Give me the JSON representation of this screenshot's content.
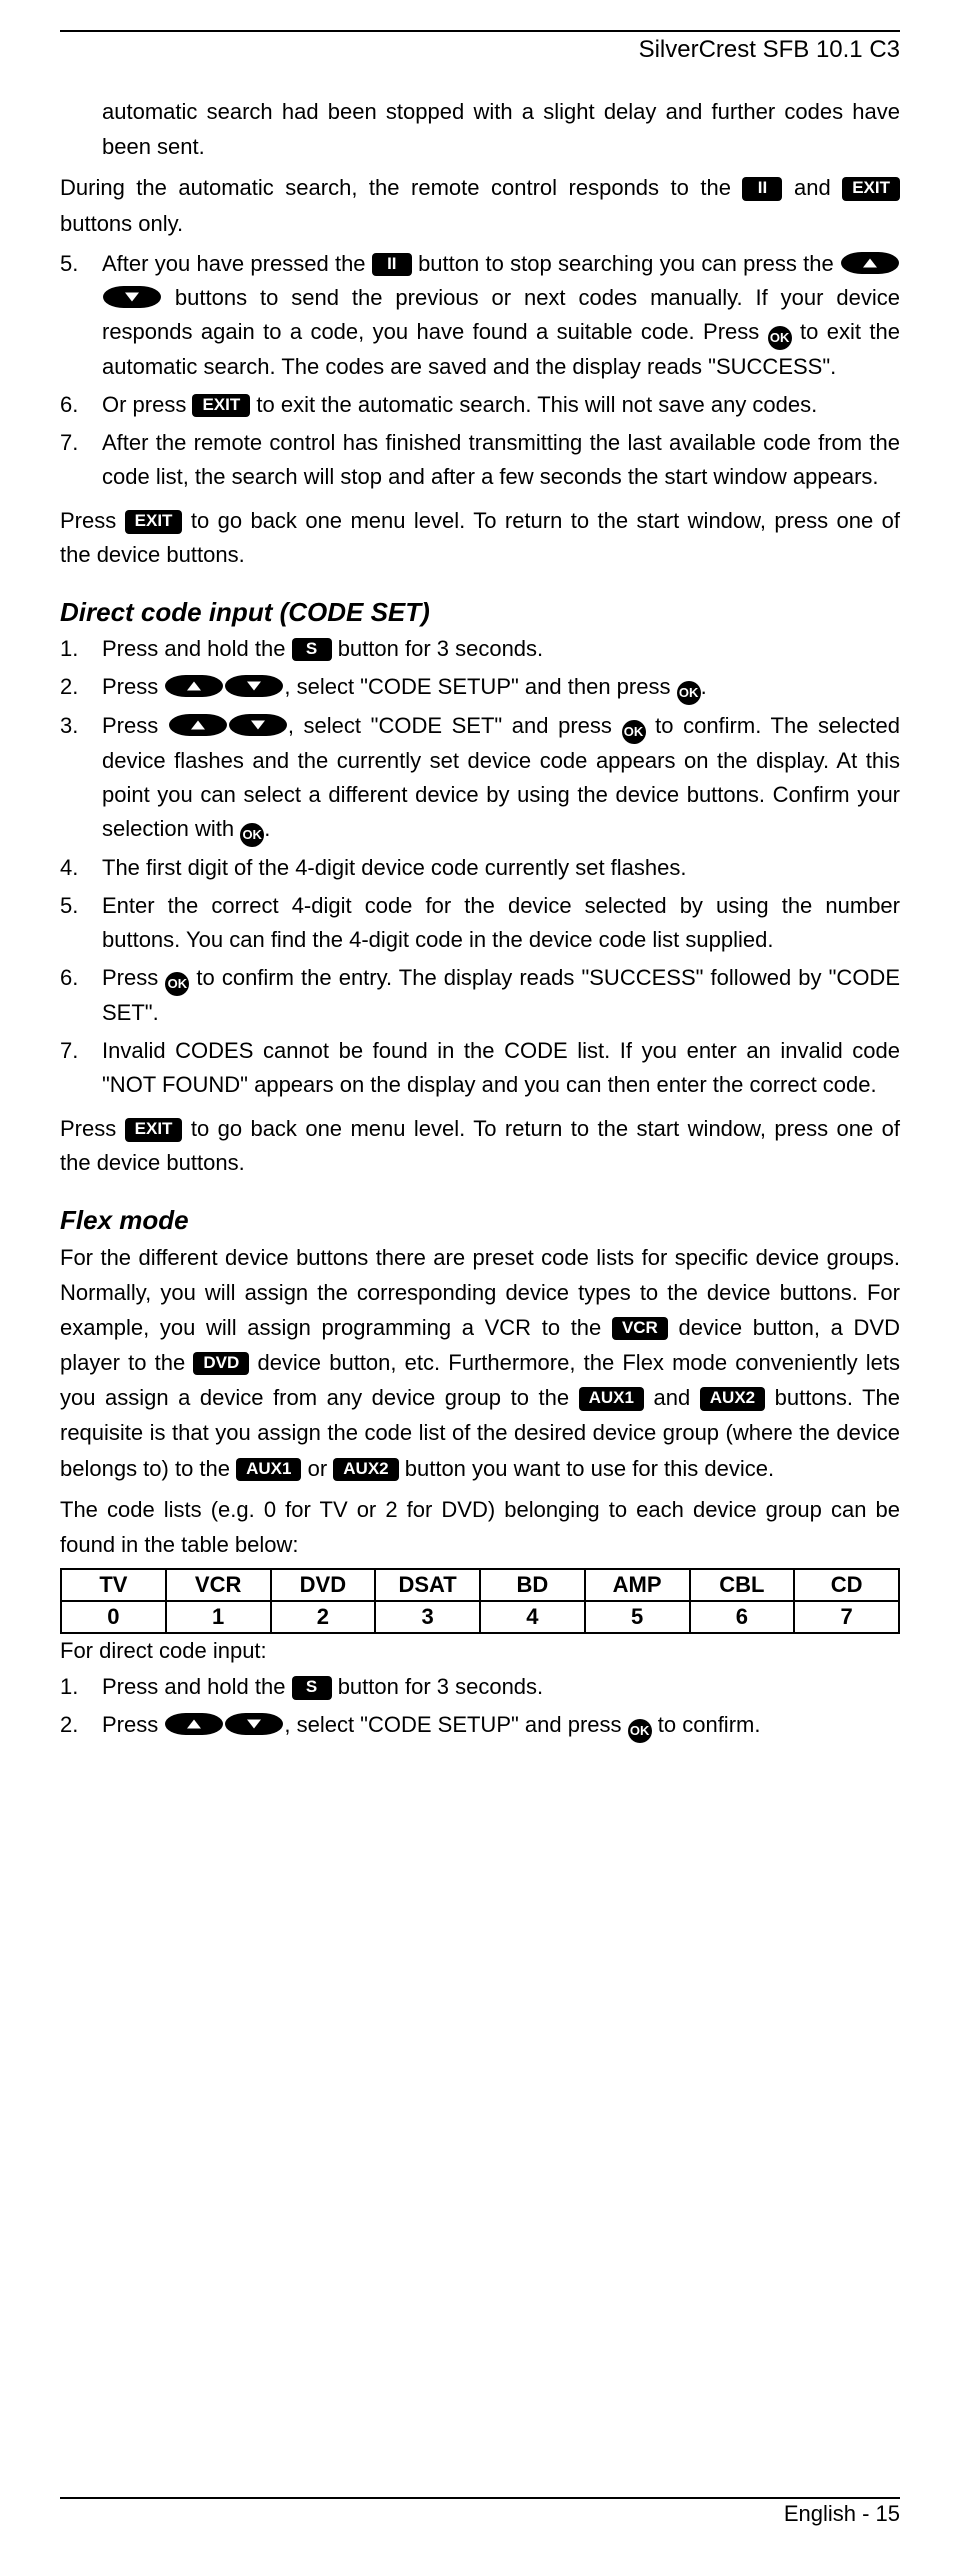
{
  "brand": "SilverCrest SFB 10.1 C3",
  "btn": {
    "pause": "II",
    "exit": "EXIT",
    "s": "S",
    "ok": "OK",
    "vcr": "VCR",
    "dvd": "DVD",
    "aux1": "AUX1",
    "aux2": "AUX2"
  },
  "intro": {
    "p1": "automatic search had been stopped with a slight delay and further codes have been sent.",
    "p2a": "During the automatic search, the remote control responds to the ",
    "p2b": " and ",
    "p2c": " buttons only."
  },
  "list1": {
    "i5a": "After you have pressed the ",
    "i5b": " button to stop searching you can press the ",
    "i5c": " buttons to send the previous or next codes manually. If your device responds again to a code, you have found a suitable code. Press ",
    "i5d": " to exit the automatic search. The codes are saved and the display reads \"SUCCESS\".",
    "i6a": "Or press ",
    "i6b": " to exit the automatic search. This will not save any codes.",
    "i7": "After the remote control has finished transmitting the last available code from the code list, the search will stop and after a few seconds the start window appears."
  },
  "press_back": {
    "a": "Press ",
    "b": " to go back one menu level. To return to the start window, press one of the device buttons."
  },
  "h_codeset": "Direct code input (CODE SET)",
  "list2": {
    "i1a": "Press and hold the ",
    "i1b": " button for 3 seconds.",
    "i2a": "Press ",
    "i2b": ", select \"CODE SETUP\" and then press ",
    "i2c": ".",
    "i3a": "Press ",
    "i3b": ", select \"CODE SET\" and press ",
    "i3c": " to confirm. The selected device flashes and the currently set device code appears on the display. At this point you can select a different device by using the device buttons. Confirm your selection with ",
    "i3d": ".",
    "i4": "The first digit of the 4-digit device code currently set flashes.",
    "i5": "Enter the correct 4-digit code for the device selected by using the number buttons. You can find the 4-digit code in the device code list supplied.",
    "i6a": "Press ",
    "i6b": " to confirm the entry. The display reads \"SUCCESS\" followed by \"CODE SET\".",
    "i7": "Invalid CODES cannot be found in the CODE list. If you enter an invalid code \"NOT FOUND\" appears on the display and you can then enter the correct code."
  },
  "h_flex": "Flex mode",
  "flex": {
    "p1a": "For the different device buttons there are preset code lists for specific device groups. Normally, you will assign the corresponding device types to the device buttons. For example, you will assign programming a VCR to the ",
    "p1b": " device button, a DVD player to the ",
    "p1c": " device button, etc. Furthermore, the Flex mode conveniently lets you assign a device from any device group to the ",
    "p1d": " and ",
    "p1e": " buttons. The requisite is that you assign the code list of the desired device group (where the device belongs to) to the ",
    "p1f": " or ",
    "p1g": " button you want to use for this device.",
    "p2": "The code lists (e.g. 0 for TV or 2 for DVD) belonging to each device group can be found in the table below:"
  },
  "table": {
    "headers": [
      "TV",
      "VCR",
      "DVD",
      "DSAT",
      "BD",
      "AMP",
      "CBL",
      "CD"
    ],
    "values": [
      "0",
      "1",
      "2",
      "3",
      "4",
      "5",
      "6",
      "7"
    ]
  },
  "direct": "For direct code input:",
  "list3": {
    "i1a": "Press and hold the ",
    "i1b": " button for 3 seconds.",
    "i2a": "Press ",
    "i2b": ", select \"CODE SETUP\" and press ",
    "i2c": " to confirm."
  },
  "footer": "English - 15"
}
